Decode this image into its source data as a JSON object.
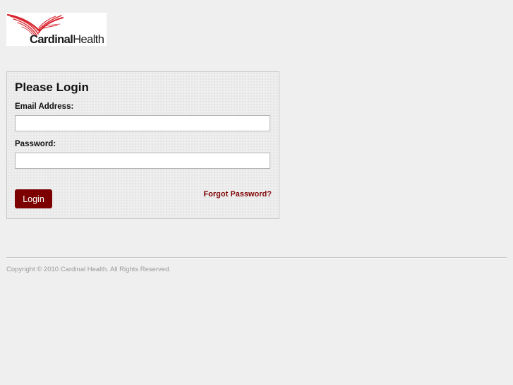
{
  "header": {
    "logo": {
      "icon": "cardinal-swoosh-icon",
      "text_bold": "Cardinal",
      "text_regular": "Health",
      "brand_color": "#d7242e"
    }
  },
  "login_form": {
    "title": "Please Login",
    "email": {
      "label": "Email Address:",
      "value": "",
      "placeholder": ""
    },
    "password": {
      "label": "Password:",
      "value": "",
      "placeholder": ""
    },
    "login_button_label": "Login",
    "forgot_password_label": "Forgot Password?",
    "accent_color": "#7d0000"
  },
  "footer": {
    "copyright": "Copyright © 2010 Cardinal Health. All Rights Reserved."
  }
}
